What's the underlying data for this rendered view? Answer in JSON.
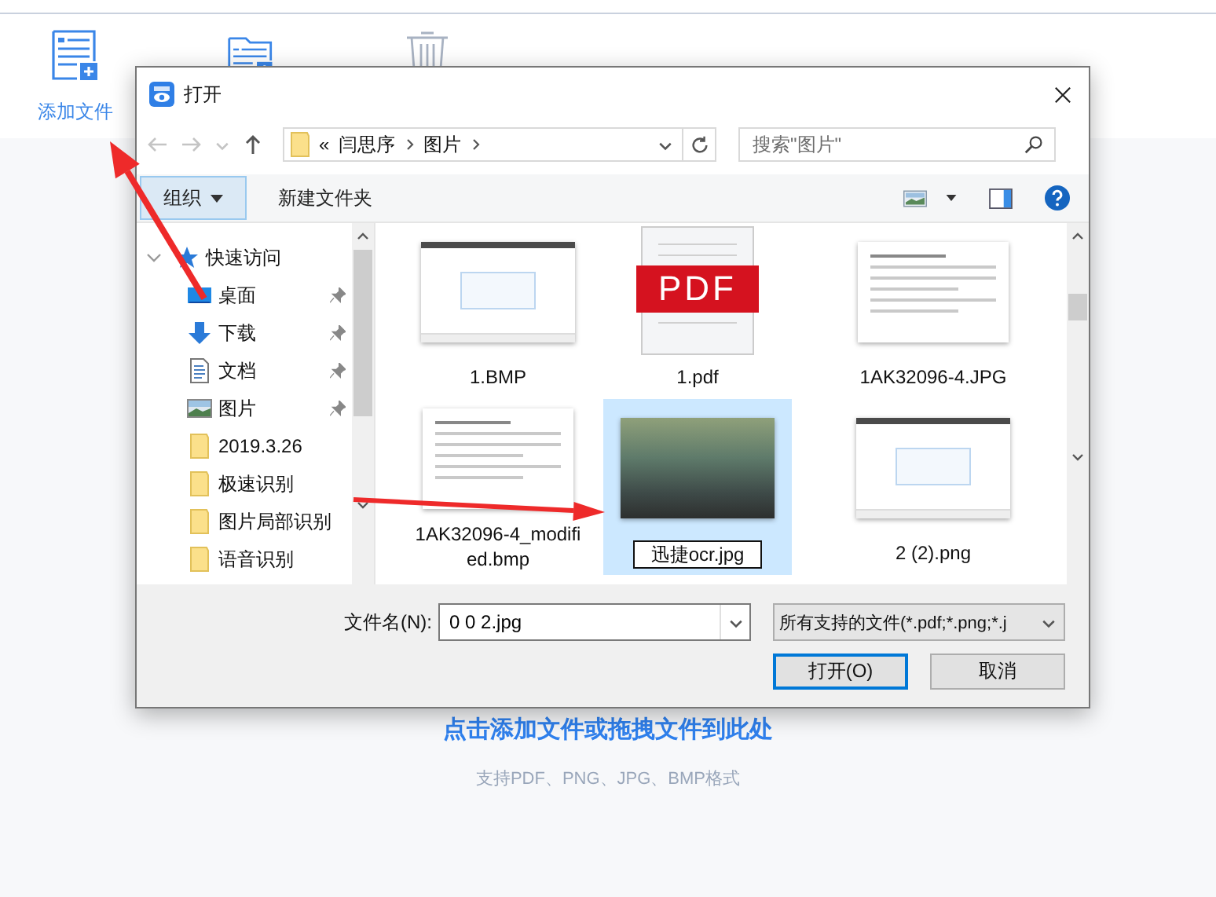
{
  "toolbar": {
    "buttons": [
      {
        "kind": "add-file",
        "label": "添加文件"
      },
      {
        "kind": "add-folder"
      },
      {
        "kind": "delete"
      }
    ]
  },
  "dialog": {
    "title": "打开",
    "address": {
      "overflow": "«",
      "segments": [
        "闫思序",
        "图片"
      ]
    },
    "search": {
      "placeholder": "搜索\"图片\""
    },
    "commands": {
      "organize": {
        "label": "组织",
        "highlighted": true
      },
      "new_folder": "新建文件夹"
    },
    "nav_pane": [
      {
        "label": "快速访问",
        "kind": "star",
        "expanded": true,
        "children": [
          {
            "label": "桌面",
            "kind": "desktop",
            "pinned": true
          },
          {
            "label": "下载",
            "kind": "download",
            "pinned": true
          },
          {
            "label": "文档",
            "kind": "document",
            "pinned": true
          },
          {
            "label": "图片",
            "kind": "picture",
            "pinned": true
          },
          {
            "label": "2019.3.26",
            "kind": "folder",
            "pinned": false
          },
          {
            "label": "极速识别",
            "kind": "folder",
            "pinned": false
          },
          {
            "label": "图片局部识别",
            "kind": "folder",
            "pinned": false
          },
          {
            "label": "语音识别",
            "kind": "folder",
            "pinned": false
          }
        ]
      }
    ],
    "files": [
      {
        "name": "1.BMP",
        "kind": "screenshot",
        "selected": false,
        "renaming": false
      },
      {
        "name": "1.pdf",
        "kind": "pdf",
        "badge": "PDF",
        "selected": false,
        "renaming": false
      },
      {
        "name": "1AK32096-4.JPG",
        "kind": "document",
        "selected": false,
        "renaming": false
      },
      {
        "name": "1AK32096-4_modified.bmp",
        "kind": "document",
        "selected": false,
        "renaming": false
      },
      {
        "name": "迅捷ocr.jpg",
        "kind": "photo",
        "selected": true,
        "renaming": true
      },
      {
        "name": "2 (2).png",
        "kind": "screenshot",
        "selected": false,
        "renaming": false
      }
    ],
    "filename": {
      "label": "文件名(N):",
      "value": "0 0 2.jpg"
    },
    "file_type": "所有支持的文件(*.pdf;*.png;*.j",
    "buttons": [
      {
        "label": "打开(O)",
        "default": true
      },
      {
        "label": "取消",
        "default": false
      }
    ]
  },
  "drop_hint": "点击添加文件或拖拽文件到此处",
  "formats": "支持PDF、PNG、JPG、BMP格式"
}
